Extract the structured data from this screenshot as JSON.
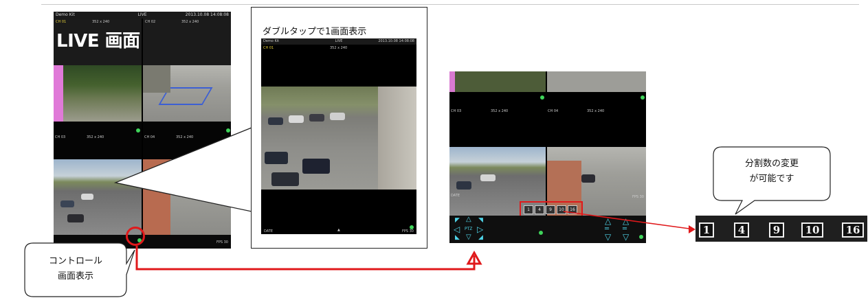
{
  "live_screen": {
    "label": "LIVE 画面",
    "top_bar": {
      "left": "Demo Kit",
      "center": "LIVE",
      "right": "2013.10.08 14:08:08"
    },
    "channels": {
      "ch01": "CH 01",
      "ch02": "CH 02",
      "ch03": "CH 03",
      "ch04": "CH 04",
      "res": "352 x 240"
    },
    "bottom": {
      "fps": "FPS 30"
    }
  },
  "zoom_view": {
    "caption": "ダブルタップで1画面表示",
    "top_bar": {
      "left": "Demo Kit",
      "center": "LIVE",
      "right": "2013.10.08 14:08:08"
    },
    "channel": "CH 01",
    "res": "352 x 240",
    "bottom": {
      "left": "DATE",
      "fps": "FPS 30"
    }
  },
  "control_screen": {
    "channels": {
      "ch03": "CH 03",
      "ch04": "CH 04",
      "res": "352 x 240"
    },
    "fps": "FPS 30",
    "left_label": "DATE",
    "ptz_label": "PTZ",
    "split_buttons": [
      "1",
      "4",
      "9",
      "10",
      "16"
    ]
  },
  "split_strip": {
    "buttons": [
      "1",
      "4",
      "9",
      "10",
      "16"
    ]
  },
  "callouts": {
    "split_line1": "分割数の変更",
    "split_line2": "が可能です",
    "control_line1": "コントロール",
    "control_line2": "画面表示"
  },
  "colors": {
    "arrow_red": "#e0191b",
    "status_green": "#3fd45a",
    "ptz_cyan": "#4fd4e8"
  }
}
